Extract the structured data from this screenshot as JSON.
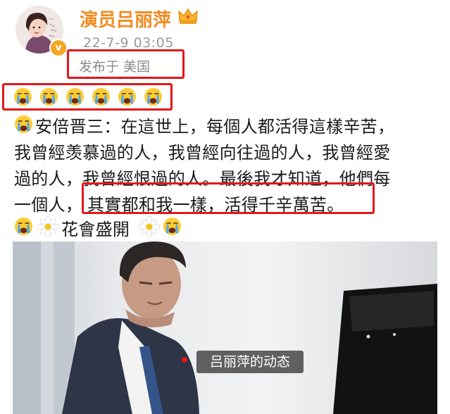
{
  "header": {
    "username": "演员吕丽萍",
    "timestamp": "22-7-9 03:05",
    "location": "发布于 美国"
  },
  "post": {
    "lines": [
      "安倍晋三：在這世上，每個人都活得這樣辛苦，",
      "我曾經羡慕過的人，我曾經向往過的人，我曾經愛",
      "過的人，我曾經恨過的人。最後我才知道，他們每",
      "一個人，",
      "其實都和我一樣，活得千辛萬苦。",
      "花會盛開"
    ]
  },
  "video": {
    "caption": "吕丽萍的动态"
  },
  "colors": {
    "username": "#f28a1e",
    "highlight_box": "#e3171a",
    "verified_badge": "#f5a623"
  },
  "icons": {
    "crying_emoji": "loudly-crying-face-icon",
    "flower_emoji": "blossom-icon",
    "crown": "crown-icon"
  }
}
